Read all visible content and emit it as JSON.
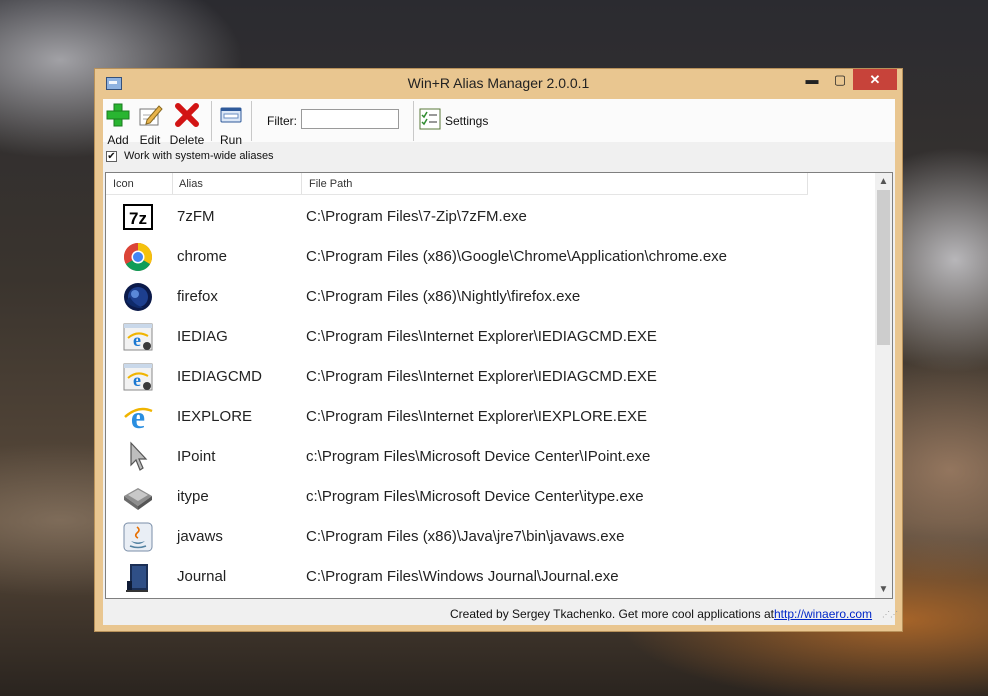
{
  "window": {
    "title": "Win+R Alias Manager 2.0.0.1",
    "controls": {
      "minimize": "▬",
      "maximize": "▢",
      "close": "✕"
    }
  },
  "toolbar": {
    "add_label": "Add",
    "edit_label": "Edit",
    "delete_label": "Delete",
    "run_label": "Run",
    "filter_label": "Filter:",
    "filter_value": "",
    "settings_label": "Settings",
    "icons": {
      "add": "plus-icon",
      "edit": "notepad-pencil-icon",
      "delete": "red-x-icon",
      "run": "run-window-icon",
      "settings": "checklist-icon"
    }
  },
  "options": {
    "system_wide_checked": true,
    "system_wide_label": "Work with system-wide aliases"
  },
  "list": {
    "columns": [
      "Icon",
      "Alias",
      "File Path"
    ],
    "rows": [
      {
        "alias": "7zFM",
        "path": "C:\\Program Files\\7-Zip\\7zFM.exe",
        "icon": "7zip-icon"
      },
      {
        "alias": "chrome",
        "path": "C:\\Program Files (x86)\\Google\\Chrome\\Application\\chrome.exe",
        "icon": "chrome-icon"
      },
      {
        "alias": "firefox",
        "path": "C:\\Program Files (x86)\\Nightly\\firefox.exe",
        "icon": "firefox-nightly-icon"
      },
      {
        "alias": "IEDIAG",
        "path": "C:\\Program Files\\Internet Explorer\\IEDIAGCMD.EXE",
        "icon": "ie-diag-icon"
      },
      {
        "alias": "IEDIAGCMD",
        "path": "C:\\Program Files\\Internet Explorer\\IEDIAGCMD.EXE",
        "icon": "ie-diag-icon"
      },
      {
        "alias": "IEXPLORE",
        "path": "C:\\Program Files\\Internet Explorer\\IEXPLORE.EXE",
        "icon": "internet-explorer-icon"
      },
      {
        "alias": "IPoint",
        "path": "c:\\Program Files\\Microsoft Device Center\\IPoint.exe",
        "icon": "mouse-pointer-icon"
      },
      {
        "alias": "itype",
        "path": "c:\\Program Files\\Microsoft Device Center\\itype.exe",
        "icon": "keyboard-key-icon"
      },
      {
        "alias": "javaws",
        "path": "C:\\Program Files (x86)\\Java\\jre7\\bin\\javaws.exe",
        "icon": "java-icon"
      },
      {
        "alias": "Journal",
        "path": "C:\\Program Files\\Windows Journal\\Journal.exe",
        "icon": "journal-icon"
      }
    ]
  },
  "status": {
    "credit": "Created by Sergey Tkachenko. Get more cool applications at",
    "link": "http://winaero.com"
  },
  "colors": {
    "window_frame": "#e9c690",
    "close_button": "#c7433a",
    "link": "#0026c8"
  }
}
